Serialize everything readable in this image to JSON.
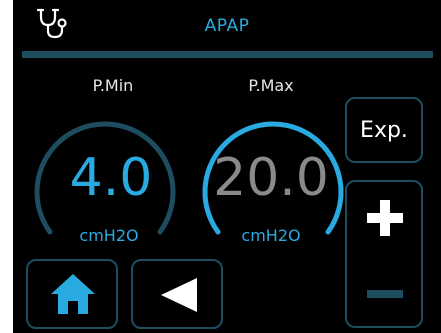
{
  "header": {
    "title": "APAP",
    "icon": "stethoscope-icon",
    "accent_color": "#29abe2"
  },
  "gauges": [
    {
      "name": "pmin",
      "label": "P.Min",
      "value": "4.0",
      "unit": "cmH2O",
      "active": false
    },
    {
      "name": "pmax",
      "label": "P.Max",
      "value": "20.0",
      "unit": "cmH2O",
      "active": true
    }
  ],
  "buttons": {
    "exp_label": "Exp.",
    "increase_icon": "plus-icon",
    "decrease_icon": "minus-icon",
    "home_icon": "home-icon",
    "back_icon": "back-arrow-icon"
  },
  "colors": {
    "accent": "#29abe2",
    "inactive_ring": "#1f4d60",
    "inactive_value": "#8a8a8a",
    "divider": "#1f4d60"
  }
}
